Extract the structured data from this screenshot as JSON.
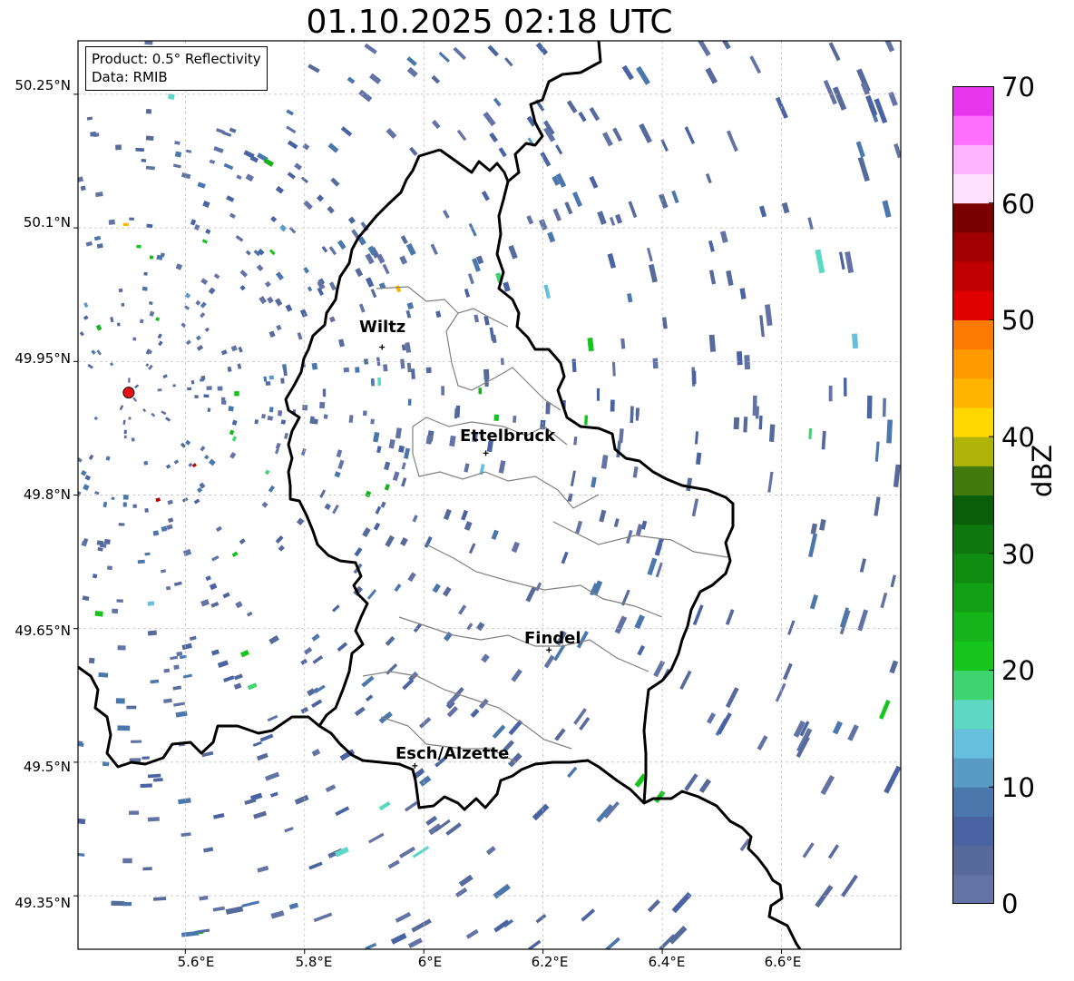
{
  "title": "01.10.2025 02:18 UTC",
  "info": {
    "product": "Product: 0.5° Reflectivity",
    "data": "Data: RMIB"
  },
  "map": {
    "lon_range": [
      5.42,
      6.8
    ],
    "lat_range": [
      49.29,
      50.31
    ],
    "lat_ticks": [
      "50.25°N",
      "50.1°N",
      "49.95°N",
      "49.8°N",
      "49.65°N",
      "49.5°N",
      "49.35°N"
    ],
    "lon_ticks": [
      "5.6°E",
      "5.8°E",
      "6°E",
      "6.2°E",
      "6.4°E",
      "6.6°E"
    ],
    "radar_site": {
      "lon": 5.505,
      "lat": 49.915,
      "color": "#e81010"
    },
    "cities": [
      {
        "name": "Wiltz",
        "lon": 5.93,
        "lat": 49.966
      },
      {
        "name": "Ettelbruck",
        "lon": 6.104,
        "lat": 49.847
      },
      {
        "name": "Findel",
        "lon": 6.21,
        "lat": 49.626
      },
      {
        "name": "Esch/Alzette",
        "lon": 5.985,
        "lat": 49.496
      }
    ]
  },
  "colorbar": {
    "label": "dBZ",
    "ticks": [
      "0",
      "10",
      "20",
      "30",
      "40",
      "50",
      "60",
      "70"
    ],
    "min": 0,
    "max": 70,
    "colors": [
      "#6473a6",
      "#566a9c",
      "#4a63a2",
      "#4a78ad",
      "#5a9bc6",
      "#66c0dc",
      "#5cd8c4",
      "#3ed470",
      "#16c41e",
      "#14b41a",
      "#12a014",
      "#108c10",
      "#0e780e",
      "#0a5e0a",
      "#437a0e",
      "#b0b40a",
      "#ffd700",
      "#ffb400",
      "#ff9a00",
      "#ff7a00",
      "#e00000",
      "#c00000",
      "#a00000",
      "#7a0000",
      "#ffe0ff",
      "#ffb4ff",
      "#ff70ff",
      "#e636ee"
    ]
  },
  "colors": {
    "echo_weak": "#5a6ea6",
    "echo_mid": "#4a78ad",
    "border": "#000000",
    "canton": "#808080",
    "grid": "#bbbbbb"
  }
}
